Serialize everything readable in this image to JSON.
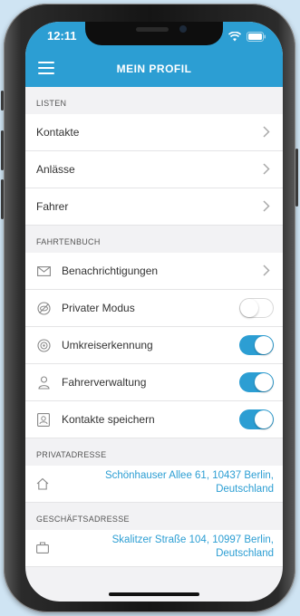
{
  "status_bar": {
    "time": "12:11"
  },
  "header": {
    "title": "MEIN PROFIL",
    "menu_icon": "hamburger-menu-icon"
  },
  "sections": {
    "listen": {
      "heading": "LISTEN",
      "items": [
        {
          "label": "Kontakte"
        },
        {
          "label": "Anlässe"
        },
        {
          "label": "Fahrer"
        }
      ]
    },
    "fahrtenbuch": {
      "heading": "FAHRTENBUCH",
      "items": [
        {
          "label": "Benachrichtigungen",
          "icon": "envelope-icon",
          "control": "chevron"
        },
        {
          "label": "Privater Modus",
          "icon": "eye-off-icon",
          "control": "toggle",
          "on": false
        },
        {
          "label": "Umkreiserkennung",
          "icon": "radar-icon",
          "control": "toggle",
          "on": true
        },
        {
          "label": "Fahrerverwaltung",
          "icon": "person-icon",
          "control": "toggle",
          "on": true
        },
        {
          "label": "Kontakte speichern",
          "icon": "contact-card-icon",
          "control": "toggle",
          "on": true
        }
      ]
    },
    "privatadresse": {
      "heading": "PRIVATADRESSE",
      "address_line1": "Schönhauser Allee 61, 10437 Berlin,",
      "address_line2": "Deutschland",
      "icon": "home-icon"
    },
    "geschaeftsadresse": {
      "heading": "GESCHÄFTSADRESSE",
      "address_line1": "Skalitzer Straße 104, 10997 Berlin,",
      "address_line2": "Deutschland",
      "icon": "briefcase-icon"
    }
  },
  "colors": {
    "accent": "#2c9ed3",
    "background": "#f2f2f4",
    "text": "#333333"
  }
}
